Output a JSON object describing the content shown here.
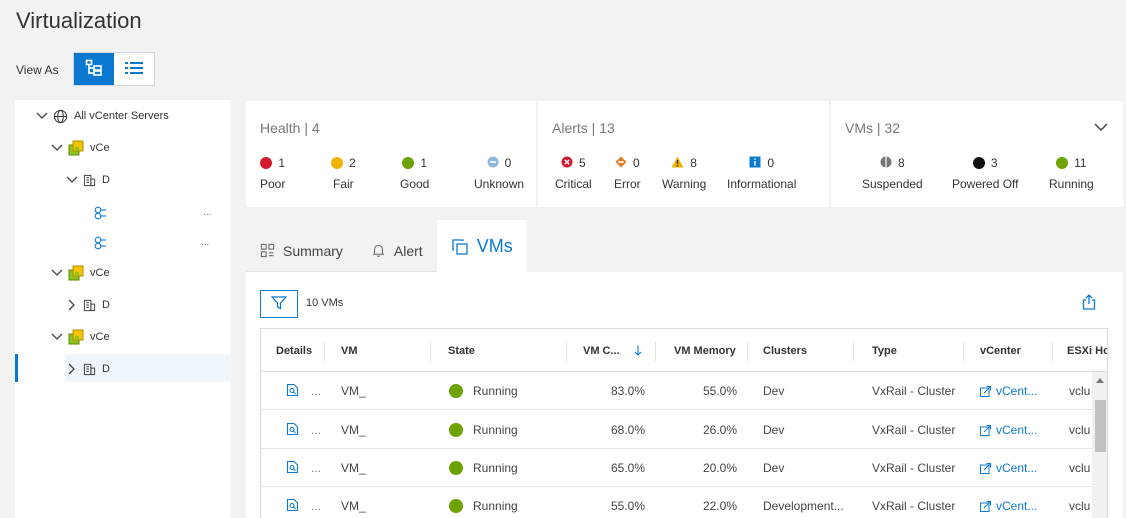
{
  "page": {
    "title": "Virtualization",
    "view_as_label": "View As"
  },
  "tree": {
    "root_label": "All vCenter Servers",
    "vcenter_label_1": "vCe",
    "vcenter_label_2": "vCe",
    "vcenter_label_3": "vCe",
    "dc_label_1": "D",
    "dc_label_2": "D",
    "dc_label_3": "D",
    "trail_1": "...",
    "trail_2": "..."
  },
  "health": {
    "title": "Health | 4",
    "items": [
      {
        "count": "1",
        "label": "Poor",
        "color": "#d0192e"
      },
      {
        "count": "2",
        "label": "Fair",
        "color": "#f2b200"
      },
      {
        "count": "1",
        "label": "Good",
        "color": "#6ea204"
      },
      {
        "count": "0",
        "label": "Unknown",
        "color": "#8fb8de"
      }
    ]
  },
  "alerts": {
    "title": "Alerts | 13",
    "items": [
      {
        "count": "5",
        "label": "Critical",
        "color": "#d0192e"
      },
      {
        "count": "0",
        "label": "Error",
        "color": "#e07b28"
      },
      {
        "count": "8",
        "label": "Warning",
        "color": "#f2b200"
      },
      {
        "count": "0",
        "label": "Informational",
        "color": "#0b79d0"
      }
    ]
  },
  "vms": {
    "title": "VMs | 32",
    "items": [
      {
        "count": "8",
        "label": "Suspended",
        "color": "#777777"
      },
      {
        "count": "3",
        "label": "Powered Off",
        "color": "#111111"
      },
      {
        "count": "11",
        "label": "Running",
        "color": "#6ea204"
      }
    ]
  },
  "tabs": {
    "summary": "Summary",
    "alert": "Alert",
    "vms": "VMs"
  },
  "toolbar": {
    "vm_count": "10 VMs"
  },
  "table": {
    "headers": {
      "details": "Details",
      "vm": "VM",
      "state": "State",
      "vm_cpu": "VM C...",
      "vm_memory": "VM Memory",
      "clusters": "Clusters",
      "type": "Type",
      "vcenter": "vCenter",
      "esxi": "ESXi Ho"
    },
    "rows": [
      {
        "details": "...",
        "vm": "VM_",
        "state": "Running",
        "cpu": "83.0%",
        "memory": "55.0%",
        "cluster": "Dev",
        "type": "VxRail - Cluster",
        "vcenter": "vCent...",
        "esxi": "vclu"
      },
      {
        "details": "...",
        "vm": "VM_",
        "state": "Running",
        "cpu": "68.0%",
        "memory": "26.0%",
        "cluster": "Dev",
        "type": "VxRail - Cluster",
        "vcenter": "vCent...",
        "esxi": "vclu"
      },
      {
        "details": "...",
        "vm": "VM_",
        "state": "Running",
        "cpu": "65.0%",
        "memory": "20.0%",
        "cluster": "Dev",
        "type": "VxRail - Cluster",
        "vcenter": "vCent...",
        "esxi": "vclu"
      },
      {
        "details": "...",
        "vm": "VM_",
        "state": "Running",
        "cpu": "55.0%",
        "memory": "22.0%",
        "cluster": "Development...",
        "type": "VxRail - Cluster",
        "vcenter": "vCent...",
        "esxi": "vclu"
      }
    ]
  },
  "colors": {
    "accent": "#0b79d0",
    "running": "#6ea204"
  }
}
